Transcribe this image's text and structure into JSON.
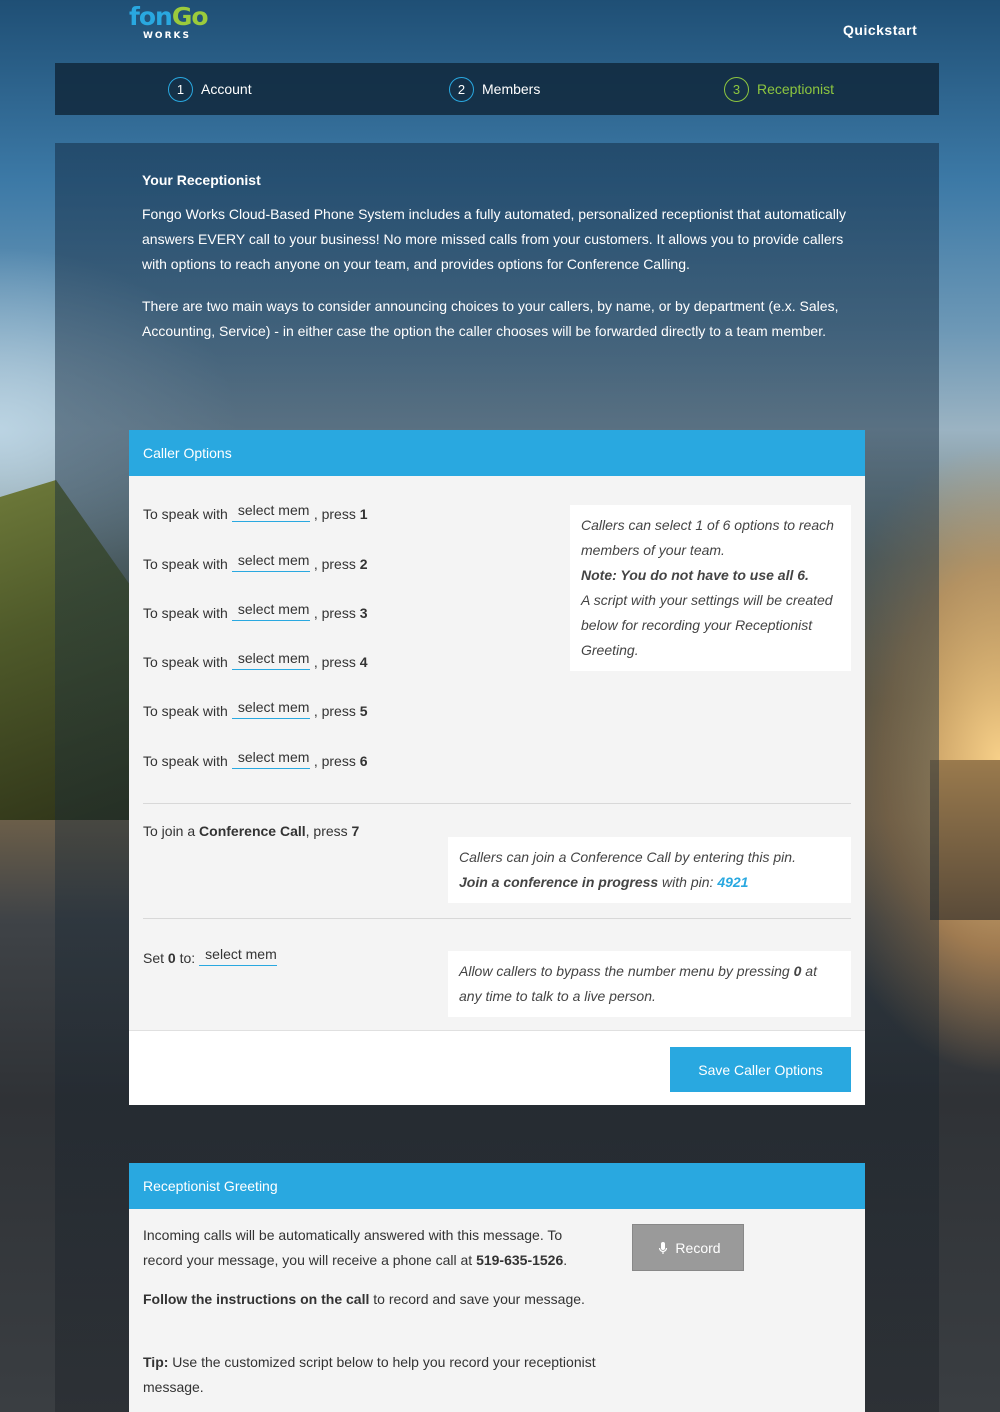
{
  "brand": {
    "logo_top": "fonGo",
    "logo_bottom": "WORKS"
  },
  "header": {
    "quickstart": "Quickstart"
  },
  "steps": [
    {
      "num": "1",
      "label": "Account"
    },
    {
      "num": "2",
      "label": "Members"
    },
    {
      "num": "3",
      "label": "Receptionist",
      "active": true
    }
  ],
  "intro": {
    "title": "Your Receptionist",
    "p1": "Fongo Works Cloud-Based Phone System includes a fully automated, personalized receptionist that automatically answers EVERY call to your business! No more missed calls from your customers. It allows you to provide callers with options to reach anyone on your team, and provides options for Conference Calling.",
    "p2": "There are two main ways to consider announcing choices to your callers, by name, or by department (e.x. Sales, Accounting, Service) - in either case the option the caller chooses will be forwarded directly to a team member."
  },
  "caller_options": {
    "title": "Caller Options",
    "rows": [
      {
        "prefix": "To speak with",
        "select": "select member",
        "suffix": ", press",
        "key": "1"
      },
      {
        "prefix": "To speak with",
        "select": "select member",
        "suffix": ", press",
        "key": "2"
      },
      {
        "prefix": "To speak with",
        "select": "select member",
        "suffix": ", press",
        "key": "3"
      },
      {
        "prefix": "To speak with",
        "select": "select member",
        "suffix": ", press",
        "key": "4"
      },
      {
        "prefix": "To speak with",
        "select": "select member",
        "suffix": ", press",
        "key": "5"
      },
      {
        "prefix": "To speak with",
        "select": "select member",
        "suffix": ", press",
        "key": "6"
      }
    ],
    "info": {
      "line1": "Callers can select 1 of 6 options to reach members of your team.",
      "note": "Note: You do not have to use all 6.",
      "line2": "A script with your settings will be created below for recording your Receptionist Greeting."
    },
    "conference": {
      "prefix": "To join a",
      "bold": "Conference Call",
      "suffix": ", press",
      "key": "7",
      "info_line1": "Callers can join a Conference Call by entering this pin.",
      "info_bold": "Join a conference in progress",
      "info_mid": " with pin: ",
      "pin": "4921"
    },
    "zero": {
      "prefix": "Set",
      "key": "0",
      "suffix": "to:",
      "select": "select member",
      "info_pre": "Allow callers to bypass the number menu by pressing ",
      "info_key": "0",
      "info_post": " at any time to talk to a live person."
    },
    "save_label": "Save Caller Options"
  },
  "greeting": {
    "title": "Receptionist Greeting",
    "p1_pre": "Incoming calls will be automatically answered with this message. To record your message, you will receive a phone call at ",
    "phone": "519-635-1526",
    "p1_post": ".",
    "p2_bold": "Follow the instructions on the call",
    "p2_rest": " to record and save your message.",
    "p3_bold": "Tip:",
    "p3_rest": " Use the customized script below to help you record your receptionist message.",
    "record_label": "Record"
  },
  "colors": {
    "accent": "#29a8e0",
    "green": "#8dc63f",
    "record_gray": "#9a9a9a"
  }
}
